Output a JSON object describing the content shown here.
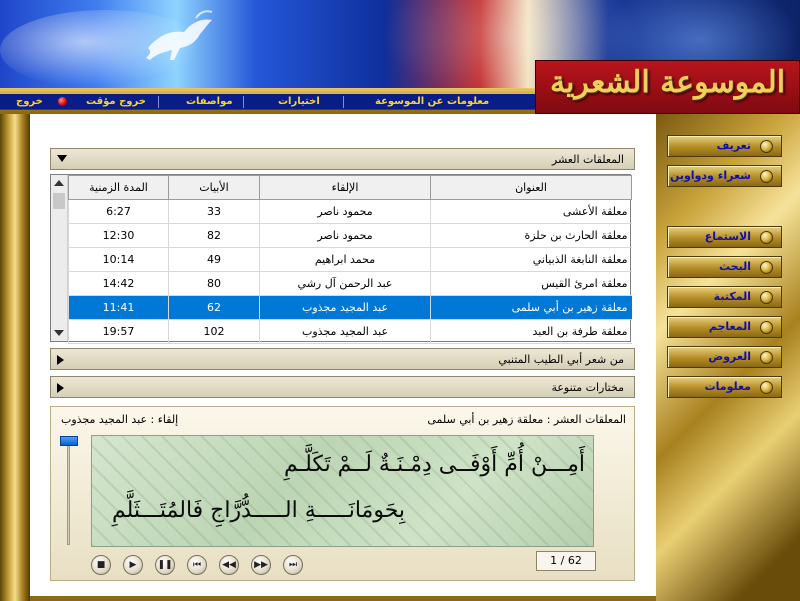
{
  "app": {
    "logo_text": "الموسوعة الشعرية"
  },
  "menu": {
    "items": [
      {
        "id": "about",
        "label": "معلومات عن الموسوعة"
      },
      {
        "id": "options",
        "label": "اختيارات"
      },
      {
        "id": "specs",
        "label": "مواصفات"
      },
      {
        "id": "temp-exit",
        "label": "خروج مؤقت"
      },
      {
        "id": "exit",
        "label": "خروج"
      }
    ]
  },
  "nav": {
    "items": [
      {
        "id": "intro",
        "label": "تعريف"
      },
      {
        "id": "poets",
        "label": "شعراء ودواوين"
      },
      {
        "id": "listen",
        "label": "الاستماع"
      },
      {
        "id": "search",
        "label": "البحث"
      },
      {
        "id": "library",
        "label": "المكتبة"
      },
      {
        "id": "dictionaries",
        "label": "المعاجم"
      },
      {
        "id": "prosody",
        "label": "العروض"
      },
      {
        "id": "info",
        "label": "معلومات"
      }
    ]
  },
  "sections": [
    {
      "title": "المعلقات العشر",
      "expanded": true
    },
    {
      "title": "من شعر أبي الطيب المتنبي",
      "expanded": false
    },
    {
      "title": "مختارات متنوعة",
      "expanded": false
    }
  ],
  "table": {
    "columns": [
      "العنوان",
      "الإلقاء",
      "الأبيات",
      "المدة الزمنية"
    ],
    "rows": [
      {
        "title": "معلقة الأعشى",
        "reciter": "محمود ناصر",
        "verses": "33",
        "duration": "6:27",
        "selected": false
      },
      {
        "title": "معلقة الحارث بن حلزة",
        "reciter": "محمود ناصر",
        "verses": "82",
        "duration": "12:30",
        "selected": false
      },
      {
        "title": "معلقة النابغة الذبياني",
        "reciter": "محمد ابراهيم",
        "verses": "49",
        "duration": "10:14",
        "selected": false
      },
      {
        "title": "معلقة امرئ القيس",
        "reciter": "عبد الرحمن آل رشي",
        "verses": "80",
        "duration": "14:42",
        "selected": false
      },
      {
        "title": "معلقة زهير بن أبي سلمى",
        "reciter": "عبد المجيد مجذوب",
        "verses": "62",
        "duration": "11:41",
        "selected": true
      },
      {
        "title": "معلقة طرفة بن العبد",
        "reciter": "عبد المجيد مجذوب",
        "verses": "102",
        "duration": "19:57",
        "selected": false
      }
    ]
  },
  "player": {
    "now_playing": "المعلقات العشر : معلقة زهير بن أبي سلمى",
    "reciter_label": "إلقاء : عبد المجيد مجذوب",
    "verse_line1": "أَمِـــنْ أُمِّ أَوْفَــى دِمْـنَـةٌ لَــمْ تَكَلَّـمِ",
    "verse_line2": "بِحَومَانَـــــةِ الـــــدُّرَّاجِ فَالمُتَـــثَلَّمِ",
    "counter": "1 / 62",
    "controls": [
      "stop-icon",
      "play-icon",
      "pause-icon",
      "skip-start-icon",
      "rewind-icon",
      "fast-forward-icon",
      "skip-end-icon"
    ]
  }
}
